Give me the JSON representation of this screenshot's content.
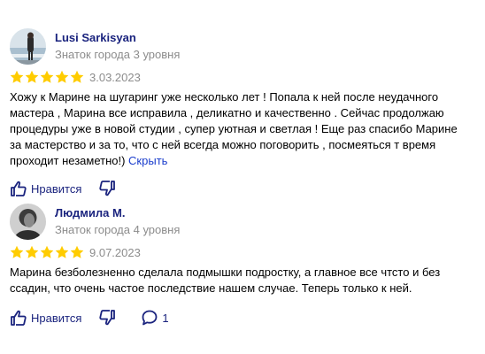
{
  "colors": {
    "accent": "#1a237e",
    "star": "#ffcc00",
    "muted": "#8c8c8c",
    "link": "#1a3dcc"
  },
  "reviews": [
    {
      "author": "Lusi Sarkisyan",
      "level": "Знаток города 3 уровня",
      "rating": 5,
      "date": "3.03.2023",
      "text": "Хожу к Марине на шугаринг уже несколько лет ! Попала к ней после неудачного мастера , Марина все исправила , деликатно и качественно . Сейчас продолжаю процедуры уже в новой студии , супер уютная и светлая ! Еще раз спасибо Марине за мастерство и за то, что с ней всегда можно поговорить , посмеяться т время проходит незаметно!)",
      "hide_label": "Скрыть",
      "like_label": "Нравится"
    },
    {
      "author": "Людмила М.",
      "level": "Знаток города 4 уровня",
      "rating": 5,
      "date": "9.07.2023",
      "text": "Марина безболезненно сделала подмышки подростку, а главное все чтсто и без ссадин, что очень частое последствие нашем случае. Теперь только к ней.",
      "like_label": "Нравится",
      "comment_count": "1"
    }
  ]
}
